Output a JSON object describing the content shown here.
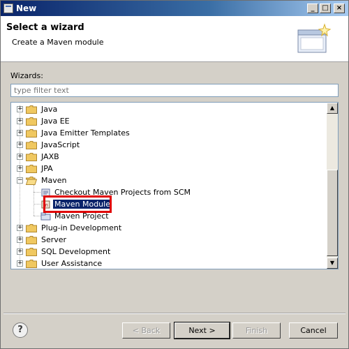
{
  "window": {
    "title": "New",
    "controls": {
      "minimize": "_",
      "maximize": "□",
      "close": "×"
    }
  },
  "header": {
    "title": "Select a wizard",
    "subtitle": "Create a Maven module",
    "banner_icon": "wizard-banner-icon"
  },
  "wizards_label": "Wizards:",
  "filter": {
    "placeholder": "type filter text",
    "value": ""
  },
  "tree": {
    "items": [
      {
        "label": "Java",
        "expanded": false,
        "icon": "folder-icon"
      },
      {
        "label": "Java EE",
        "expanded": false,
        "icon": "folder-icon"
      },
      {
        "label": "Java Emitter Templates",
        "expanded": false,
        "icon": "folder-icon"
      },
      {
        "label": "JavaScript",
        "expanded": false,
        "icon": "folder-icon"
      },
      {
        "label": "JAXB",
        "expanded": false,
        "icon": "folder-icon"
      },
      {
        "label": "JPA",
        "expanded": false,
        "icon": "folder-icon"
      },
      {
        "label": "Maven",
        "expanded": true,
        "icon": "open-folder-icon"
      },
      {
        "label": "Checkout Maven Projects from SCM",
        "child": true,
        "icon": "maven-checkout-icon"
      },
      {
        "label": "Maven Module",
        "child": true,
        "selected": true,
        "icon": "maven-module-icon"
      },
      {
        "label": "Maven Project",
        "child": true,
        "icon": "maven-project-icon"
      },
      {
        "label": "Plug-in Development",
        "expanded": false,
        "icon": "folder-icon"
      },
      {
        "label": "Server",
        "expanded": false,
        "icon": "folder-icon"
      },
      {
        "label": "SQL Development",
        "expanded": false,
        "icon": "folder-icon"
      },
      {
        "label": "User Assistance",
        "expanded": false,
        "icon": "folder-icon"
      }
    ]
  },
  "buttons": {
    "help": "?",
    "back": "< Back",
    "next": "Next >",
    "finish": "Finish",
    "cancel": "Cancel"
  }
}
